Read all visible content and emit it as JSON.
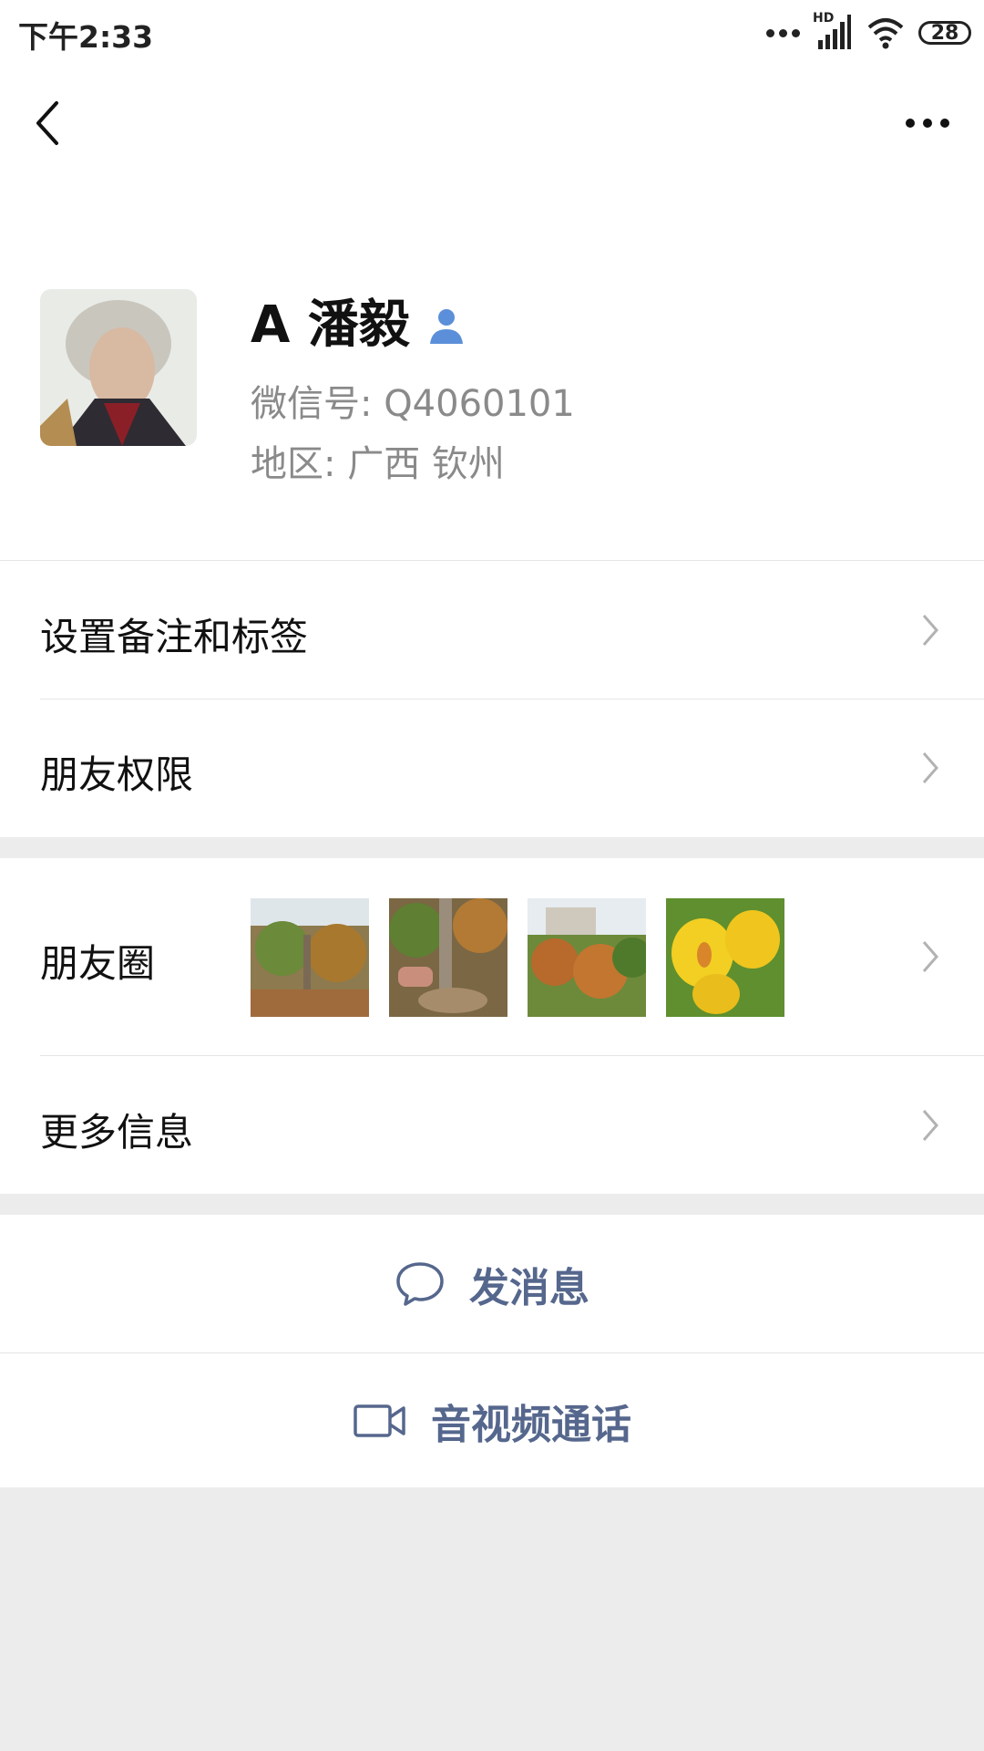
{
  "status_bar": {
    "time": "下午2:33",
    "network": "HD",
    "battery": "28"
  },
  "nav": {
    "back_icon": "back-chevron-icon",
    "more_icon": "more-icon"
  },
  "profile": {
    "name": "A 潘毅",
    "wechat_id": "微信号:  Q4060101",
    "region": "地区:  广西  钦州"
  },
  "menu": {
    "remark_tags": "设置备注和标签",
    "friend_permissions": "朋友权限",
    "moments": "朋友圈",
    "more_info": "更多信息"
  },
  "actions": {
    "send_message": "发消息",
    "video_call": "音视频通话"
  },
  "colors": {
    "accent": "#56678d",
    "verified_icon": "#5b8fd9",
    "background": "#ececec"
  }
}
